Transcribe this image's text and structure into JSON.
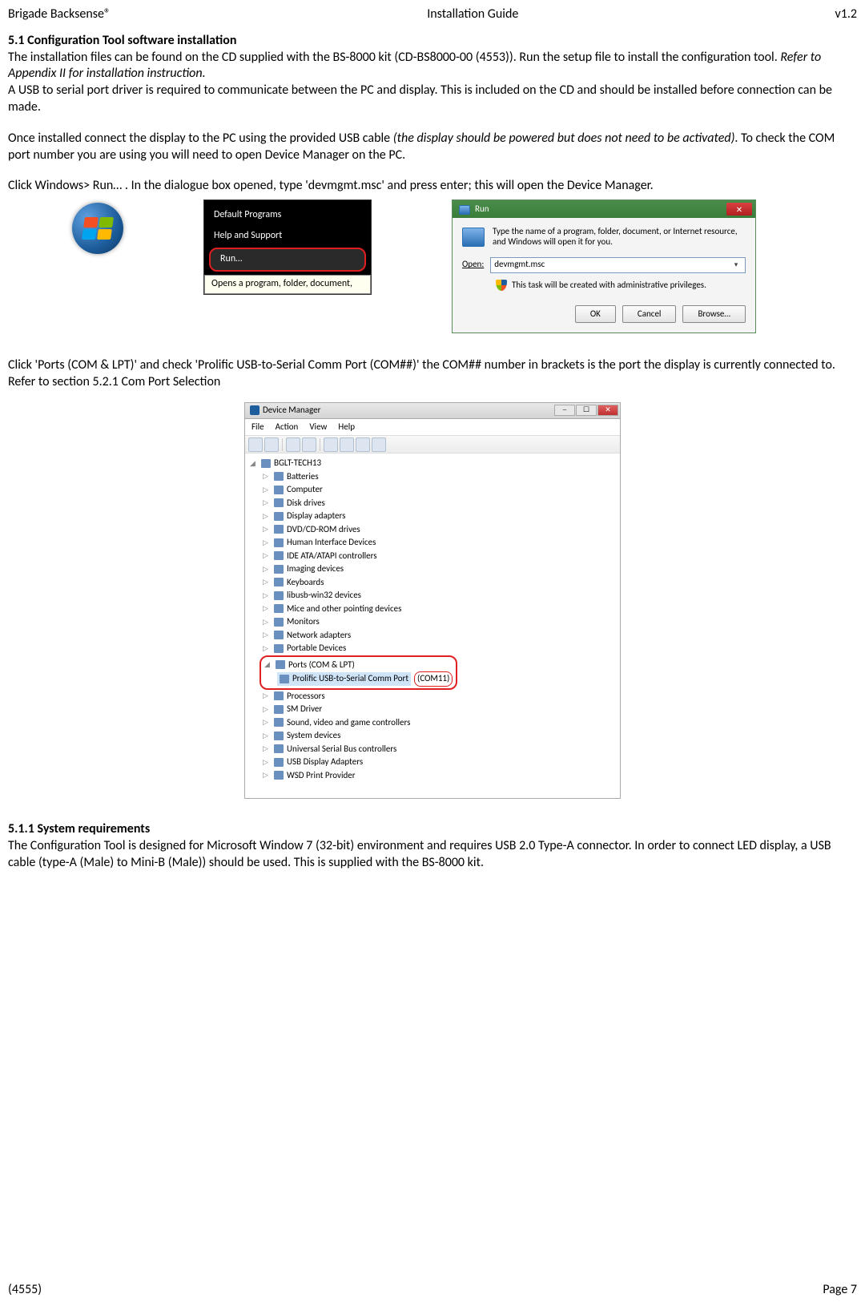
{
  "header": {
    "left": "Brigade Backsense®",
    "center": "Installation Guide",
    "right": "v1.2"
  },
  "section_5_1_title": "5.1 Configuration Tool software installation",
  "p1": "The installation files can be found on the CD supplied with the BS-8000 kit (CD-BS8000-00 (4553)). Run the setup file to install the configuration tool. ",
  "p1_italic": "Refer to Appendix II for installation instruction.",
  "p2": "A USB to serial port driver is required to communicate between the PC and display. This is included on the CD and should be installed before connection can be made.",
  "p3a": "Once installed connect the display to the PC using the provided USB cable ",
  "p3_italic": "(the display should be powered but does not need to be activated)",
  "p3b": ". To check the COM port number you are using you will need to open Device Manager on the PC.",
  "p4": "Click Windows> Run…  . In the dialogue box opened, type 'devmgmt.msc' and press enter; this will open the Device Manager.",
  "start_menu": {
    "default_programs": "Default Programs",
    "help_support": "Help and Support",
    "run": "Run…",
    "tooltip": "Opens a program, folder, document,"
  },
  "run_dialog": {
    "title": "Run",
    "description": "Type the name of a program, folder, document, or Internet resource, and Windows will open it for you.",
    "open_label": "Open:",
    "input_value": "devmgmt.msc",
    "admin_text": "This task will be created with administrative privileges.",
    "btn_ok": "OK",
    "btn_cancel": "Cancel",
    "btn_browse": "Browse…"
  },
  "p5": "Click 'Ports (COM & LPT)' and check 'Prolific USB-to-Serial Comm Port (COM##)' the COM## number in brackets is the port the display is currently connected to. Refer to section 5.2.1 Com Port Selection",
  "devmgr": {
    "title": "Device Manager",
    "menu": {
      "file": "File",
      "action": "Action",
      "view": "View",
      "help": "Help"
    },
    "root": "BGLT-TECH13",
    "items": [
      "Batteries",
      "Computer",
      "Disk drives",
      "Display adapters",
      "DVD/CD-ROM drives",
      "Human Interface Devices",
      "IDE ATA/ATAPI controllers",
      "Imaging devices",
      "Keyboards",
      "libusb-win32 devices",
      "Mice and other pointing devices",
      "Monitors",
      "Network adapters",
      "Portable Devices"
    ],
    "ports_label": "Ports (COM & LPT)",
    "ports_child_prefix": "Prolific USB-to-Serial Comm Port",
    "ports_child_com": "(COM11)",
    "after_items": [
      "Processors",
      "SM Driver",
      "Sound, video and game controllers",
      "System devices",
      "Universal Serial Bus controllers",
      "USB Display Adapters",
      "WSD Print Provider"
    ]
  },
  "section_5_1_1_title": "5.1.1 System requirements",
  "p6": "The Configuration Tool is designed for Microsoft Window 7 (32-bit) environment and requires USB 2.0 Type-A connector. In order to connect LED display, a USB cable (type-A (Male) to Mini-B (Male)) should be used. This is supplied with the BS-8000 kit.",
  "footer": {
    "left": "(4555)",
    "right": "Page 7"
  }
}
